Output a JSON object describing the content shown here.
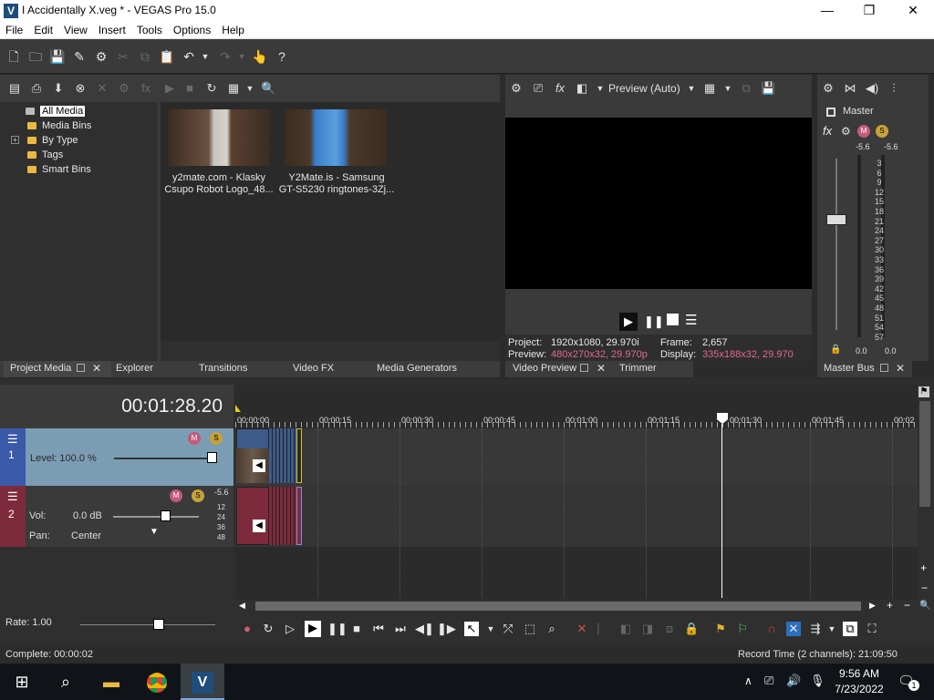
{
  "window": {
    "title": "I Accidentally X.veg * - VEGAS Pro 15.0",
    "app_icon": "V",
    "minimize": "—",
    "maximize": "❐",
    "close": "✕"
  },
  "menu": [
    "File",
    "Edit",
    "View",
    "Insert",
    "Tools",
    "Options",
    "Help"
  ],
  "project_media": {
    "tree": [
      "All Media",
      "Media Bins",
      "By Type",
      "Tags",
      "Smart Bins"
    ],
    "expander": "+",
    "items": [
      {
        "caption_line1": "y2mate.com - Klasky",
        "caption_line2": "Csupo Robot Logo_48..."
      },
      {
        "caption_line1": "Y2Mate.is - Samsung",
        "caption_line2": "GT-S5230 ringtones-3Zj..."
      }
    ]
  },
  "tabs_left": [
    "Project Media",
    "Explorer",
    "Transitions",
    "Video FX",
    "Media Generators"
  ],
  "preview": {
    "mode": "Preview (Auto)",
    "project_label": "Project:",
    "project_value": "1920x1080, 29.970i",
    "preview_label": "Preview:",
    "preview_value": "480x270x32, 29.970p",
    "frame_label": "Frame:",
    "frame_value": "2,657",
    "display_label": "Display:",
    "display_value": "335x188x32, 29.970"
  },
  "tabs_mid": [
    "Video Preview",
    "Trimmer"
  ],
  "master": {
    "label": "Master",
    "left_peak": "-5.6",
    "right_peak": "-5.6",
    "scale": [
      "3",
      "6",
      "9",
      "12",
      "15",
      "18",
      "21",
      "24",
      "27",
      "30",
      "33",
      "36",
      "39",
      "42",
      "45",
      "48",
      "51",
      "54",
      "57"
    ],
    "bottom_left": "0.0",
    "bottom_right": "0.0",
    "tab": "Master Bus"
  },
  "timeline": {
    "timecode": "00:01:28.20",
    "ruler": [
      "00:00:00",
      "00:00:15",
      "00:00:30",
      "00:00:45",
      "00:01:00",
      "00:01:15",
      "00:01:30",
      "00:01:45",
      "00:02"
    ],
    "video_track": {
      "number": "1",
      "level_label": "Level: 100.0 %"
    },
    "audio_track": {
      "number": "2",
      "vol_label": "Vol:",
      "vol_value": "0.0 dB",
      "pan_label": "Pan:",
      "pan_value": "Center",
      "peak": "-5.6",
      "scale": [
        "12",
        "24",
        "36",
        "48"
      ]
    },
    "rate": "Rate: 1.00"
  },
  "status": {
    "left": "Complete: 00:00:02",
    "right": "Record Time (2 channels): 21:09:50"
  },
  "taskbar": {
    "time": "9:56 AM",
    "date": "7/23/2022",
    "notification_count": "1"
  },
  "colors": {
    "accent": "#1f4d7a",
    "video_track": "#7b9db4",
    "audio_clip": "#7d2b3c",
    "video_clip": "#3e5a8a",
    "playhead": "#ffffff",
    "meter_peak": "#e05050"
  }
}
